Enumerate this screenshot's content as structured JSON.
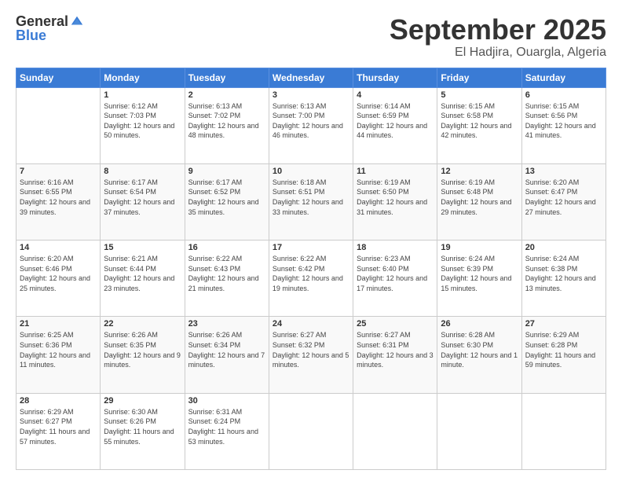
{
  "logo": {
    "general": "General",
    "blue": "Blue"
  },
  "header": {
    "month": "September 2025",
    "location": "El Hadjira, Ouargla, Algeria"
  },
  "weekdays": [
    "Sunday",
    "Monday",
    "Tuesday",
    "Wednesday",
    "Thursday",
    "Friday",
    "Saturday"
  ],
  "weeks": [
    [
      {
        "day": "",
        "sunrise": "",
        "sunset": "",
        "daylight": ""
      },
      {
        "day": "1",
        "sunrise": "Sunrise: 6:12 AM",
        "sunset": "Sunset: 7:03 PM",
        "daylight": "Daylight: 12 hours and 50 minutes."
      },
      {
        "day": "2",
        "sunrise": "Sunrise: 6:13 AM",
        "sunset": "Sunset: 7:02 PM",
        "daylight": "Daylight: 12 hours and 48 minutes."
      },
      {
        "day": "3",
        "sunrise": "Sunrise: 6:13 AM",
        "sunset": "Sunset: 7:00 PM",
        "daylight": "Daylight: 12 hours and 46 minutes."
      },
      {
        "day": "4",
        "sunrise": "Sunrise: 6:14 AM",
        "sunset": "Sunset: 6:59 PM",
        "daylight": "Daylight: 12 hours and 44 minutes."
      },
      {
        "day": "5",
        "sunrise": "Sunrise: 6:15 AM",
        "sunset": "Sunset: 6:58 PM",
        "daylight": "Daylight: 12 hours and 42 minutes."
      },
      {
        "day": "6",
        "sunrise": "Sunrise: 6:15 AM",
        "sunset": "Sunset: 6:56 PM",
        "daylight": "Daylight: 12 hours and 41 minutes."
      }
    ],
    [
      {
        "day": "7",
        "sunrise": "Sunrise: 6:16 AM",
        "sunset": "Sunset: 6:55 PM",
        "daylight": "Daylight: 12 hours and 39 minutes."
      },
      {
        "day": "8",
        "sunrise": "Sunrise: 6:17 AM",
        "sunset": "Sunset: 6:54 PM",
        "daylight": "Daylight: 12 hours and 37 minutes."
      },
      {
        "day": "9",
        "sunrise": "Sunrise: 6:17 AM",
        "sunset": "Sunset: 6:52 PM",
        "daylight": "Daylight: 12 hours and 35 minutes."
      },
      {
        "day": "10",
        "sunrise": "Sunrise: 6:18 AM",
        "sunset": "Sunset: 6:51 PM",
        "daylight": "Daylight: 12 hours and 33 minutes."
      },
      {
        "day": "11",
        "sunrise": "Sunrise: 6:19 AM",
        "sunset": "Sunset: 6:50 PM",
        "daylight": "Daylight: 12 hours and 31 minutes."
      },
      {
        "day": "12",
        "sunrise": "Sunrise: 6:19 AM",
        "sunset": "Sunset: 6:48 PM",
        "daylight": "Daylight: 12 hours and 29 minutes."
      },
      {
        "day": "13",
        "sunrise": "Sunrise: 6:20 AM",
        "sunset": "Sunset: 6:47 PM",
        "daylight": "Daylight: 12 hours and 27 minutes."
      }
    ],
    [
      {
        "day": "14",
        "sunrise": "Sunrise: 6:20 AM",
        "sunset": "Sunset: 6:46 PM",
        "daylight": "Daylight: 12 hours and 25 minutes."
      },
      {
        "day": "15",
        "sunrise": "Sunrise: 6:21 AM",
        "sunset": "Sunset: 6:44 PM",
        "daylight": "Daylight: 12 hours and 23 minutes."
      },
      {
        "day": "16",
        "sunrise": "Sunrise: 6:22 AM",
        "sunset": "Sunset: 6:43 PM",
        "daylight": "Daylight: 12 hours and 21 minutes."
      },
      {
        "day": "17",
        "sunrise": "Sunrise: 6:22 AM",
        "sunset": "Sunset: 6:42 PM",
        "daylight": "Daylight: 12 hours and 19 minutes."
      },
      {
        "day": "18",
        "sunrise": "Sunrise: 6:23 AM",
        "sunset": "Sunset: 6:40 PM",
        "daylight": "Daylight: 12 hours and 17 minutes."
      },
      {
        "day": "19",
        "sunrise": "Sunrise: 6:24 AM",
        "sunset": "Sunset: 6:39 PM",
        "daylight": "Daylight: 12 hours and 15 minutes."
      },
      {
        "day": "20",
        "sunrise": "Sunrise: 6:24 AM",
        "sunset": "Sunset: 6:38 PM",
        "daylight": "Daylight: 12 hours and 13 minutes."
      }
    ],
    [
      {
        "day": "21",
        "sunrise": "Sunrise: 6:25 AM",
        "sunset": "Sunset: 6:36 PM",
        "daylight": "Daylight: 12 hours and 11 minutes."
      },
      {
        "day": "22",
        "sunrise": "Sunrise: 6:26 AM",
        "sunset": "Sunset: 6:35 PM",
        "daylight": "Daylight: 12 hours and 9 minutes."
      },
      {
        "day": "23",
        "sunrise": "Sunrise: 6:26 AM",
        "sunset": "Sunset: 6:34 PM",
        "daylight": "Daylight: 12 hours and 7 minutes."
      },
      {
        "day": "24",
        "sunrise": "Sunrise: 6:27 AM",
        "sunset": "Sunset: 6:32 PM",
        "daylight": "Daylight: 12 hours and 5 minutes."
      },
      {
        "day": "25",
        "sunrise": "Sunrise: 6:27 AM",
        "sunset": "Sunset: 6:31 PM",
        "daylight": "Daylight: 12 hours and 3 minutes."
      },
      {
        "day": "26",
        "sunrise": "Sunrise: 6:28 AM",
        "sunset": "Sunset: 6:30 PM",
        "daylight": "Daylight: 12 hours and 1 minute."
      },
      {
        "day": "27",
        "sunrise": "Sunrise: 6:29 AM",
        "sunset": "Sunset: 6:28 PM",
        "daylight": "Daylight: 11 hours and 59 minutes."
      }
    ],
    [
      {
        "day": "28",
        "sunrise": "Sunrise: 6:29 AM",
        "sunset": "Sunset: 6:27 PM",
        "daylight": "Daylight: 11 hours and 57 minutes."
      },
      {
        "day": "29",
        "sunrise": "Sunrise: 6:30 AM",
        "sunset": "Sunset: 6:26 PM",
        "daylight": "Daylight: 11 hours and 55 minutes."
      },
      {
        "day": "30",
        "sunrise": "Sunrise: 6:31 AM",
        "sunset": "Sunset: 6:24 PM",
        "daylight": "Daylight: 11 hours and 53 minutes."
      },
      {
        "day": "",
        "sunrise": "",
        "sunset": "",
        "daylight": ""
      },
      {
        "day": "",
        "sunrise": "",
        "sunset": "",
        "daylight": ""
      },
      {
        "day": "",
        "sunrise": "",
        "sunset": "",
        "daylight": ""
      },
      {
        "day": "",
        "sunrise": "",
        "sunset": "",
        "daylight": ""
      }
    ]
  ]
}
